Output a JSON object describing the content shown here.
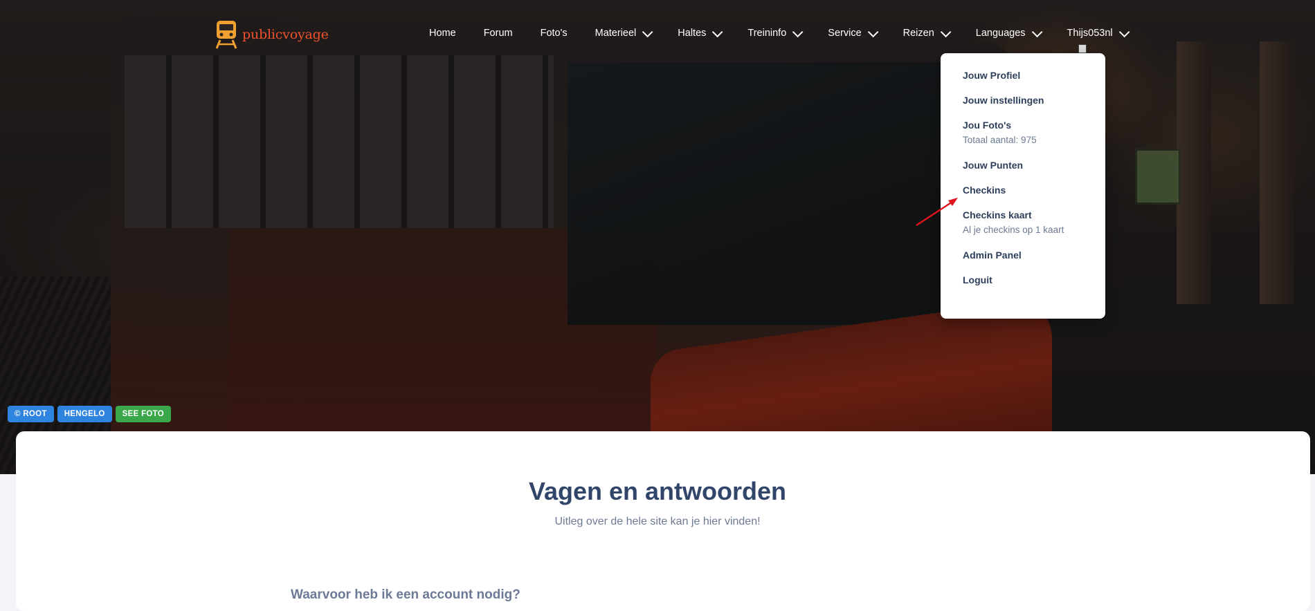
{
  "brand": {
    "name_pre": "public",
    "name_post": "voyage",
    "accent": "#f0522e"
  },
  "nav": {
    "items": [
      {
        "label": "Home",
        "dropdown": false
      },
      {
        "label": "Forum",
        "dropdown": false
      },
      {
        "label": "Foto's",
        "dropdown": false
      },
      {
        "label": "Materieel",
        "dropdown": true
      },
      {
        "label": "Haltes",
        "dropdown": true
      },
      {
        "label": "Treininfo",
        "dropdown": true
      },
      {
        "label": "Service",
        "dropdown": true
      },
      {
        "label": "Reizen",
        "dropdown": true
      },
      {
        "label": "Languages",
        "dropdown": true
      },
      {
        "label": "Thijs053nl",
        "dropdown": true
      }
    ]
  },
  "user_menu": {
    "items": [
      {
        "title": "Jouw Profiel",
        "sub": ""
      },
      {
        "title": "Jouw instellingen",
        "sub": ""
      },
      {
        "title": "Jou Foto's",
        "sub": "Totaal aantal: 975"
      },
      {
        "title": "Jouw Punten",
        "sub": ""
      },
      {
        "title": "Checkins",
        "sub": ""
      },
      {
        "title": "Checkins kaart",
        "sub": "Al je checkins op 1 kaart"
      },
      {
        "title": "Admin Panel",
        "sub": ""
      },
      {
        "title": "Loguit",
        "sub": ""
      }
    ]
  },
  "photo_badges": [
    {
      "label": "© ROOT",
      "color": "#2f84e0"
    },
    {
      "label": "HENGELO",
      "color": "#2f84e0"
    },
    {
      "label": "SEE FOTO",
      "color": "#3aa84a"
    }
  ],
  "main": {
    "title": "Vagen en antwoorden",
    "subtitle": "Uitleg over de hele site kan je hier vinden!",
    "first_question": "Waarvoor heb ik een account nodig?"
  }
}
